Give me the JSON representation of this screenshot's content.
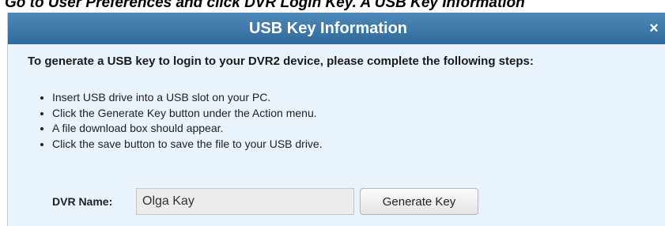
{
  "caption": "Go to User Preferences and click DVR Login Key. A USB Key Information",
  "dialog": {
    "title": "USB Key Information",
    "close_icon": "×",
    "intro": "To generate a USB key to login to your DVR2 device, please complete the following steps:",
    "steps": [
      "Insert USB drive into a USB slot on your PC.",
      "Click the Generate Key button under the Action menu.",
      "A file download box should appear.",
      "Click the save button to save the file to your USB drive."
    ],
    "dvr_name_label": "DVR Name:",
    "dvr_name_value": "Olga Kay",
    "generate_button": "Generate Key"
  },
  "colors": {
    "title_bar": "#3b76a8",
    "dialog_background": "#e9f3fb"
  }
}
